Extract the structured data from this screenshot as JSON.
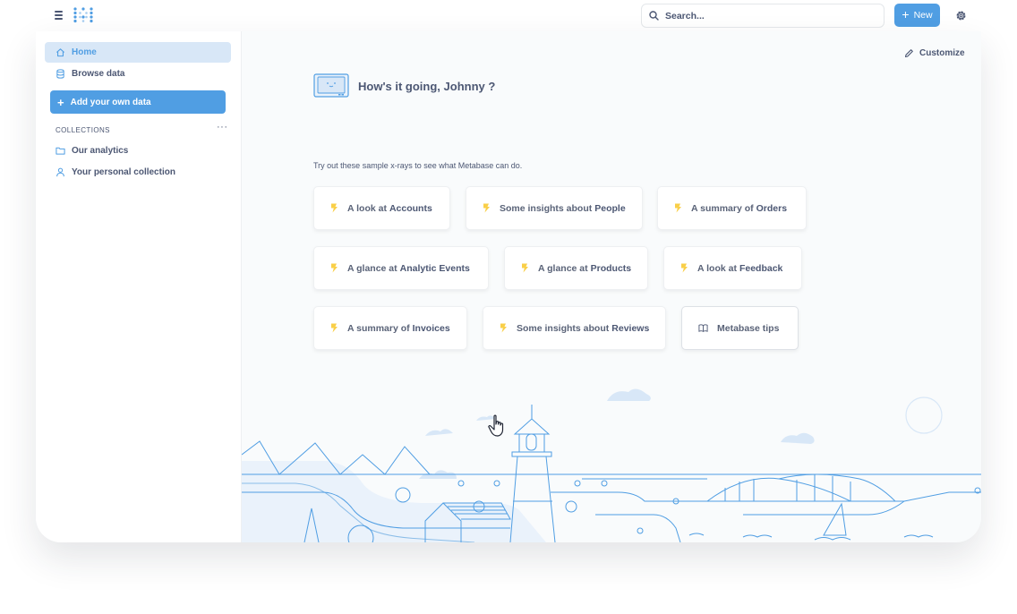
{
  "topbar": {
    "search_placeholder": "Search...",
    "new_label": "New"
  },
  "sidebar": {
    "items": [
      {
        "label": "Home",
        "icon": "home-icon",
        "active": true
      },
      {
        "label": "Browse data",
        "icon": "database-icon",
        "active": false
      }
    ],
    "add_data_label": "Add your own data",
    "collections_header": "COLLECTIONS",
    "more_label": "···",
    "collections": [
      {
        "label": "Our analytics",
        "icon": "folder-icon"
      },
      {
        "label": "Your personal collection",
        "icon": "person-icon"
      }
    ]
  },
  "main": {
    "customize_label": "Customize",
    "greeting": "How's it going, Johnny ?",
    "xray_intro": "Try out these sample x-rays to see what Metabase can do.",
    "xrays": [
      {
        "prefix": "A look at",
        "subject": "Accounts"
      },
      {
        "prefix": "Some insights about",
        "subject": "People"
      },
      {
        "prefix": "A summary of",
        "subject": "Orders"
      },
      {
        "prefix": "A glance at",
        "subject": "Analytic Events"
      },
      {
        "prefix": "A glance at",
        "subject": "Products"
      },
      {
        "prefix": "A look at",
        "subject": "Feedback"
      },
      {
        "prefix": "A summary of",
        "subject": "Invoices"
      },
      {
        "prefix": "Some insights about",
        "subject": "Reviews"
      }
    ],
    "tips_label": "Metabase tips"
  },
  "colors": {
    "brand": "#509ee3",
    "active_bg": "#d8e7f7",
    "text": "#4c5773",
    "bolt": "#f9cf48"
  }
}
